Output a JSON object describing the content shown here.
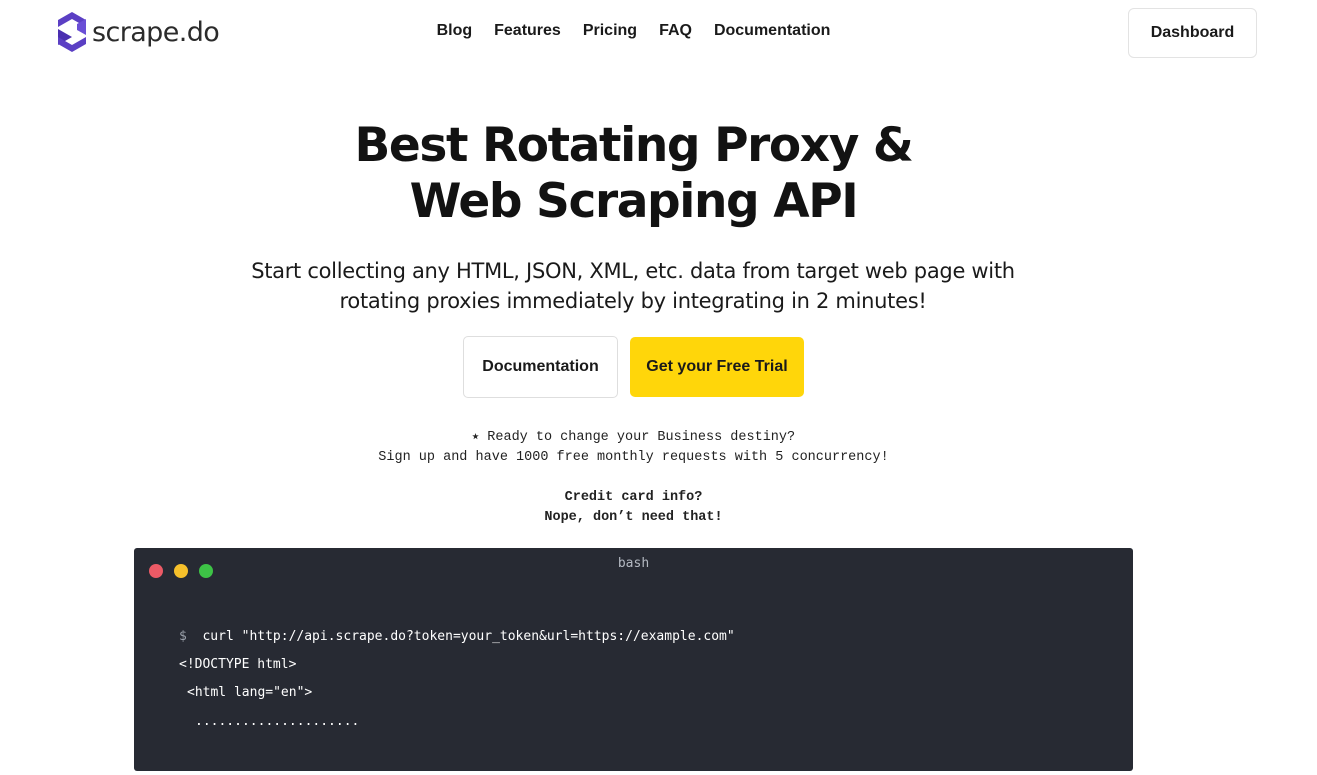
{
  "brand": {
    "name": "scrape.do",
    "color": "#5b3fc4"
  },
  "nav": {
    "items": [
      {
        "id": "blog",
        "label": "Blog"
      },
      {
        "id": "features",
        "label": "Features"
      },
      {
        "id": "pricing",
        "label": "Pricing"
      },
      {
        "id": "faq",
        "label": "FAQ"
      },
      {
        "id": "documentation",
        "label": "Documentation"
      }
    ],
    "dashboard_label": "Dashboard"
  },
  "hero": {
    "title_line1": "Best Rotating Proxy &",
    "title_line2": "Web Scraping API",
    "subtitle_line1": "Start collecting any HTML, JSON, XML, etc. data from target web page with",
    "subtitle_line2": "rotating proxies immediately by integrating in 2 minutes!",
    "docs_button": "Documentation",
    "trial_button": "Get your Free Trial",
    "trial_color": "#ffd60a"
  },
  "promo": {
    "line1": "⭑ Ready to change your Business destiny?",
    "line2": "Sign up and have 1000 free monthly requests with 5 concurrency!",
    "line3": "Credit card info?",
    "line4": "Nope, don’t need that!"
  },
  "terminal": {
    "title": "bash",
    "background": "#272a33",
    "prompt": "$",
    "command": "curl \"http://api.scrape.do?token=your_token&url=https://example.com\"",
    "output_line1": "<!DOCTYPE html>",
    "output_line2": "<html lang=\"en\">",
    "output_line3": "....................."
  }
}
